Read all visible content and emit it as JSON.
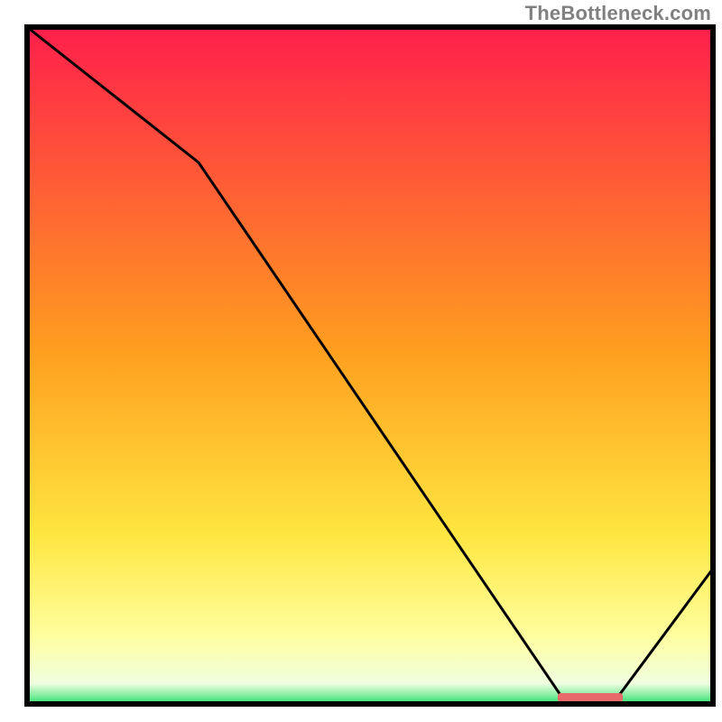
{
  "watermark": "TheBottleneck.com",
  "chart_data": {
    "type": "line",
    "title": "",
    "xlabel": "",
    "ylabel": "",
    "xlim": [
      0,
      100
    ],
    "ylim": [
      0,
      100
    ],
    "x": [
      0,
      25,
      78,
      86,
      100
    ],
    "values": [
      100,
      80,
      0,
      0,
      20
    ],
    "optimal_zone": {
      "x_start": 78,
      "x_end": 86
    },
    "background_gradient_stops": [
      {
        "offset": 0.0,
        "color": "#ff1f4b"
      },
      {
        "offset": 0.48,
        "color": "#ff9f1f"
      },
      {
        "offset": 0.75,
        "color": "#ffe640"
      },
      {
        "offset": 0.9,
        "color": "#ffff9f"
      },
      {
        "offset": 0.97,
        "color": "#f0ffe0"
      },
      {
        "offset": 1.0,
        "color": "#30e070"
      }
    ],
    "marker_color": "#e86a6a"
  }
}
